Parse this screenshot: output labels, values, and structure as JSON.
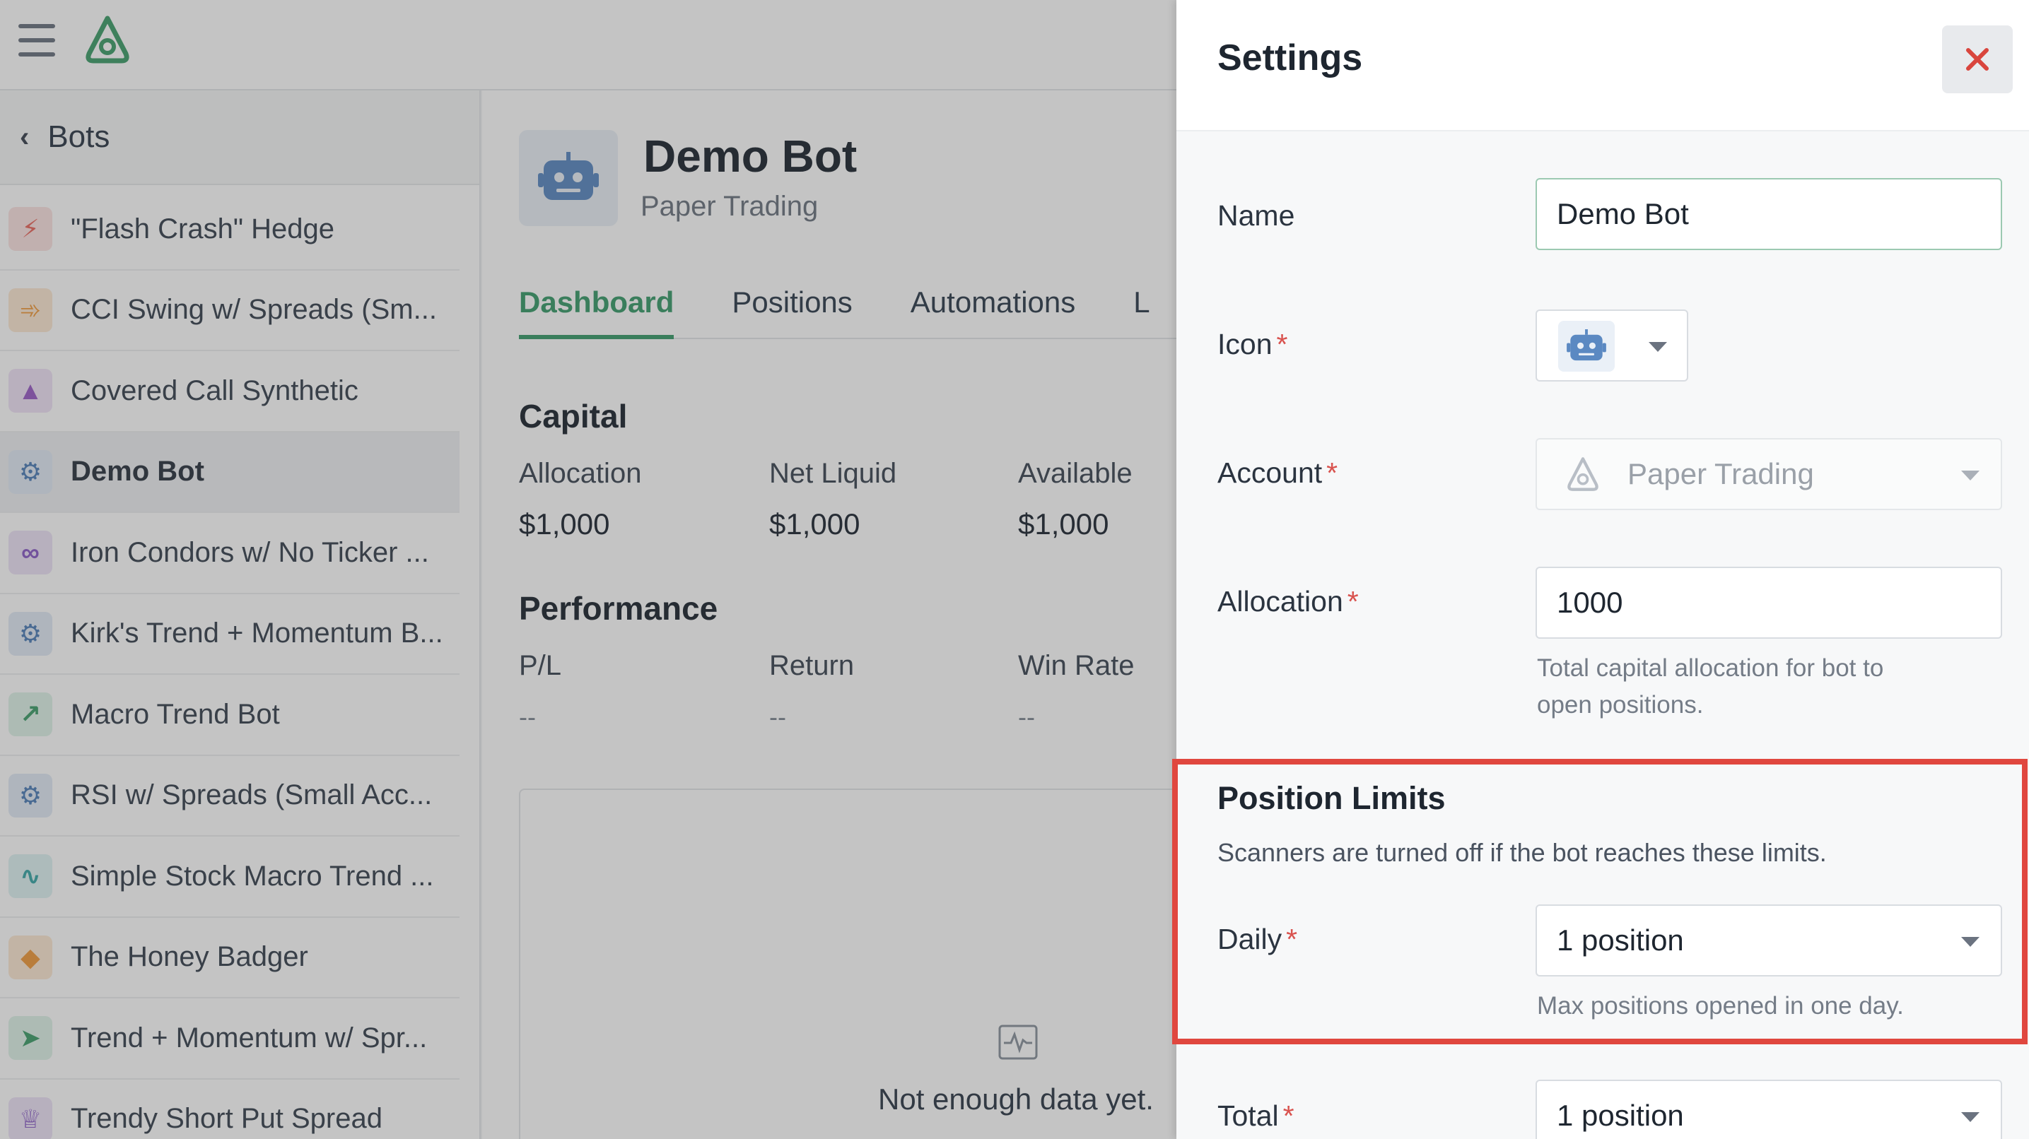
{
  "sidebar": {
    "back_label": "Bots",
    "items": [
      {
        "label": "\"Flash Crash\" Hedge",
        "icon": "lightning-icon",
        "color": "#e8675d",
        "bg": "#fbe3e1",
        "active": false
      },
      {
        "label": "CCI Swing w/ Spreads (Sm...",
        "icon": "swing-icon",
        "color": "#f09a3c",
        "bg": "#fde9d3",
        "active": false
      },
      {
        "label": "Covered Call Synthetic",
        "icon": "wizard-hat-icon",
        "color": "#9a5cc6",
        "bg": "#efe3f7",
        "active": false
      },
      {
        "label": "Demo Bot",
        "icon": "robot-icon",
        "color": "#4f7fb8",
        "bg": "#e1eaf5",
        "active": true
      },
      {
        "label": "Iron Condors w/ No Ticker ...",
        "icon": "condor-icon",
        "color": "#8a5cc6",
        "bg": "#ece3f7",
        "active": false
      },
      {
        "label": "Kirk's Trend + Momentum B...",
        "icon": "robot-icon",
        "color": "#4f7fb8",
        "bg": "#e1eaf5",
        "active": false
      },
      {
        "label": "Macro Trend Bot",
        "icon": "line-chart-icon",
        "color": "#3f9e6a",
        "bg": "#dff2e8",
        "active": false
      },
      {
        "label": "RSI w/ Spreads (Small Acc...",
        "icon": "robot-icon",
        "color": "#4f7fb8",
        "bg": "#e1eaf5",
        "active": false
      },
      {
        "label": "Simple Stock Macro Trend ...",
        "icon": "pulse-icon",
        "color": "#3aa6a6",
        "bg": "#dff2f2",
        "active": false
      },
      {
        "label": "The Honey Badger",
        "icon": "badger-icon",
        "color": "#f09a3c",
        "bg": "#fde9d3",
        "active": false
      },
      {
        "label": "Trend + Momentum w/ Spr...",
        "icon": "rocket-icon",
        "color": "#3f9e6a",
        "bg": "#dff2e8",
        "active": false
      },
      {
        "label": "Trendy Short Put Spread",
        "icon": "crown-icon",
        "color": "#8a5cc6",
        "bg": "#ece3f7",
        "active": false
      }
    ]
  },
  "main": {
    "title": "Demo Bot",
    "subtitle": "Paper Trading",
    "tabs": [
      "Dashboard",
      "Positions",
      "Automations",
      "L"
    ],
    "capital": {
      "title": "Capital",
      "labels": [
        "Allocation",
        "Net Liquid",
        "Available"
      ],
      "values": [
        "$1,000",
        "$1,000",
        "$1,000"
      ]
    },
    "performance": {
      "title": "Performance",
      "labels": [
        "P/L",
        "Return",
        "Win Rate"
      ],
      "values": [
        "--",
        "--",
        "--"
      ]
    },
    "empty_text": "Not enough data yet."
  },
  "settings": {
    "title": "Settings",
    "name_label": "Name",
    "name_value": "Demo Bot",
    "icon_label": "Icon",
    "account_label": "Account",
    "account_value": "Paper Trading",
    "allocation_label": "Allocation",
    "allocation_value": "1000",
    "allocation_help_1": "Total capital allocation for bot to",
    "allocation_help_2": "open positions.",
    "required_mark": "*",
    "position_limits_title": "Position Limits",
    "position_limits_desc": "Scanners are turned off if the bot reaches these limits.",
    "daily_label": "Daily",
    "daily_value": "1 position",
    "daily_help": "Max positions opened in one day.",
    "total_label": "Total",
    "total_value": "1 position"
  },
  "colors": {
    "accent": "#3a9b6b",
    "highlight": "#e0473f",
    "close": "#d9453d"
  }
}
